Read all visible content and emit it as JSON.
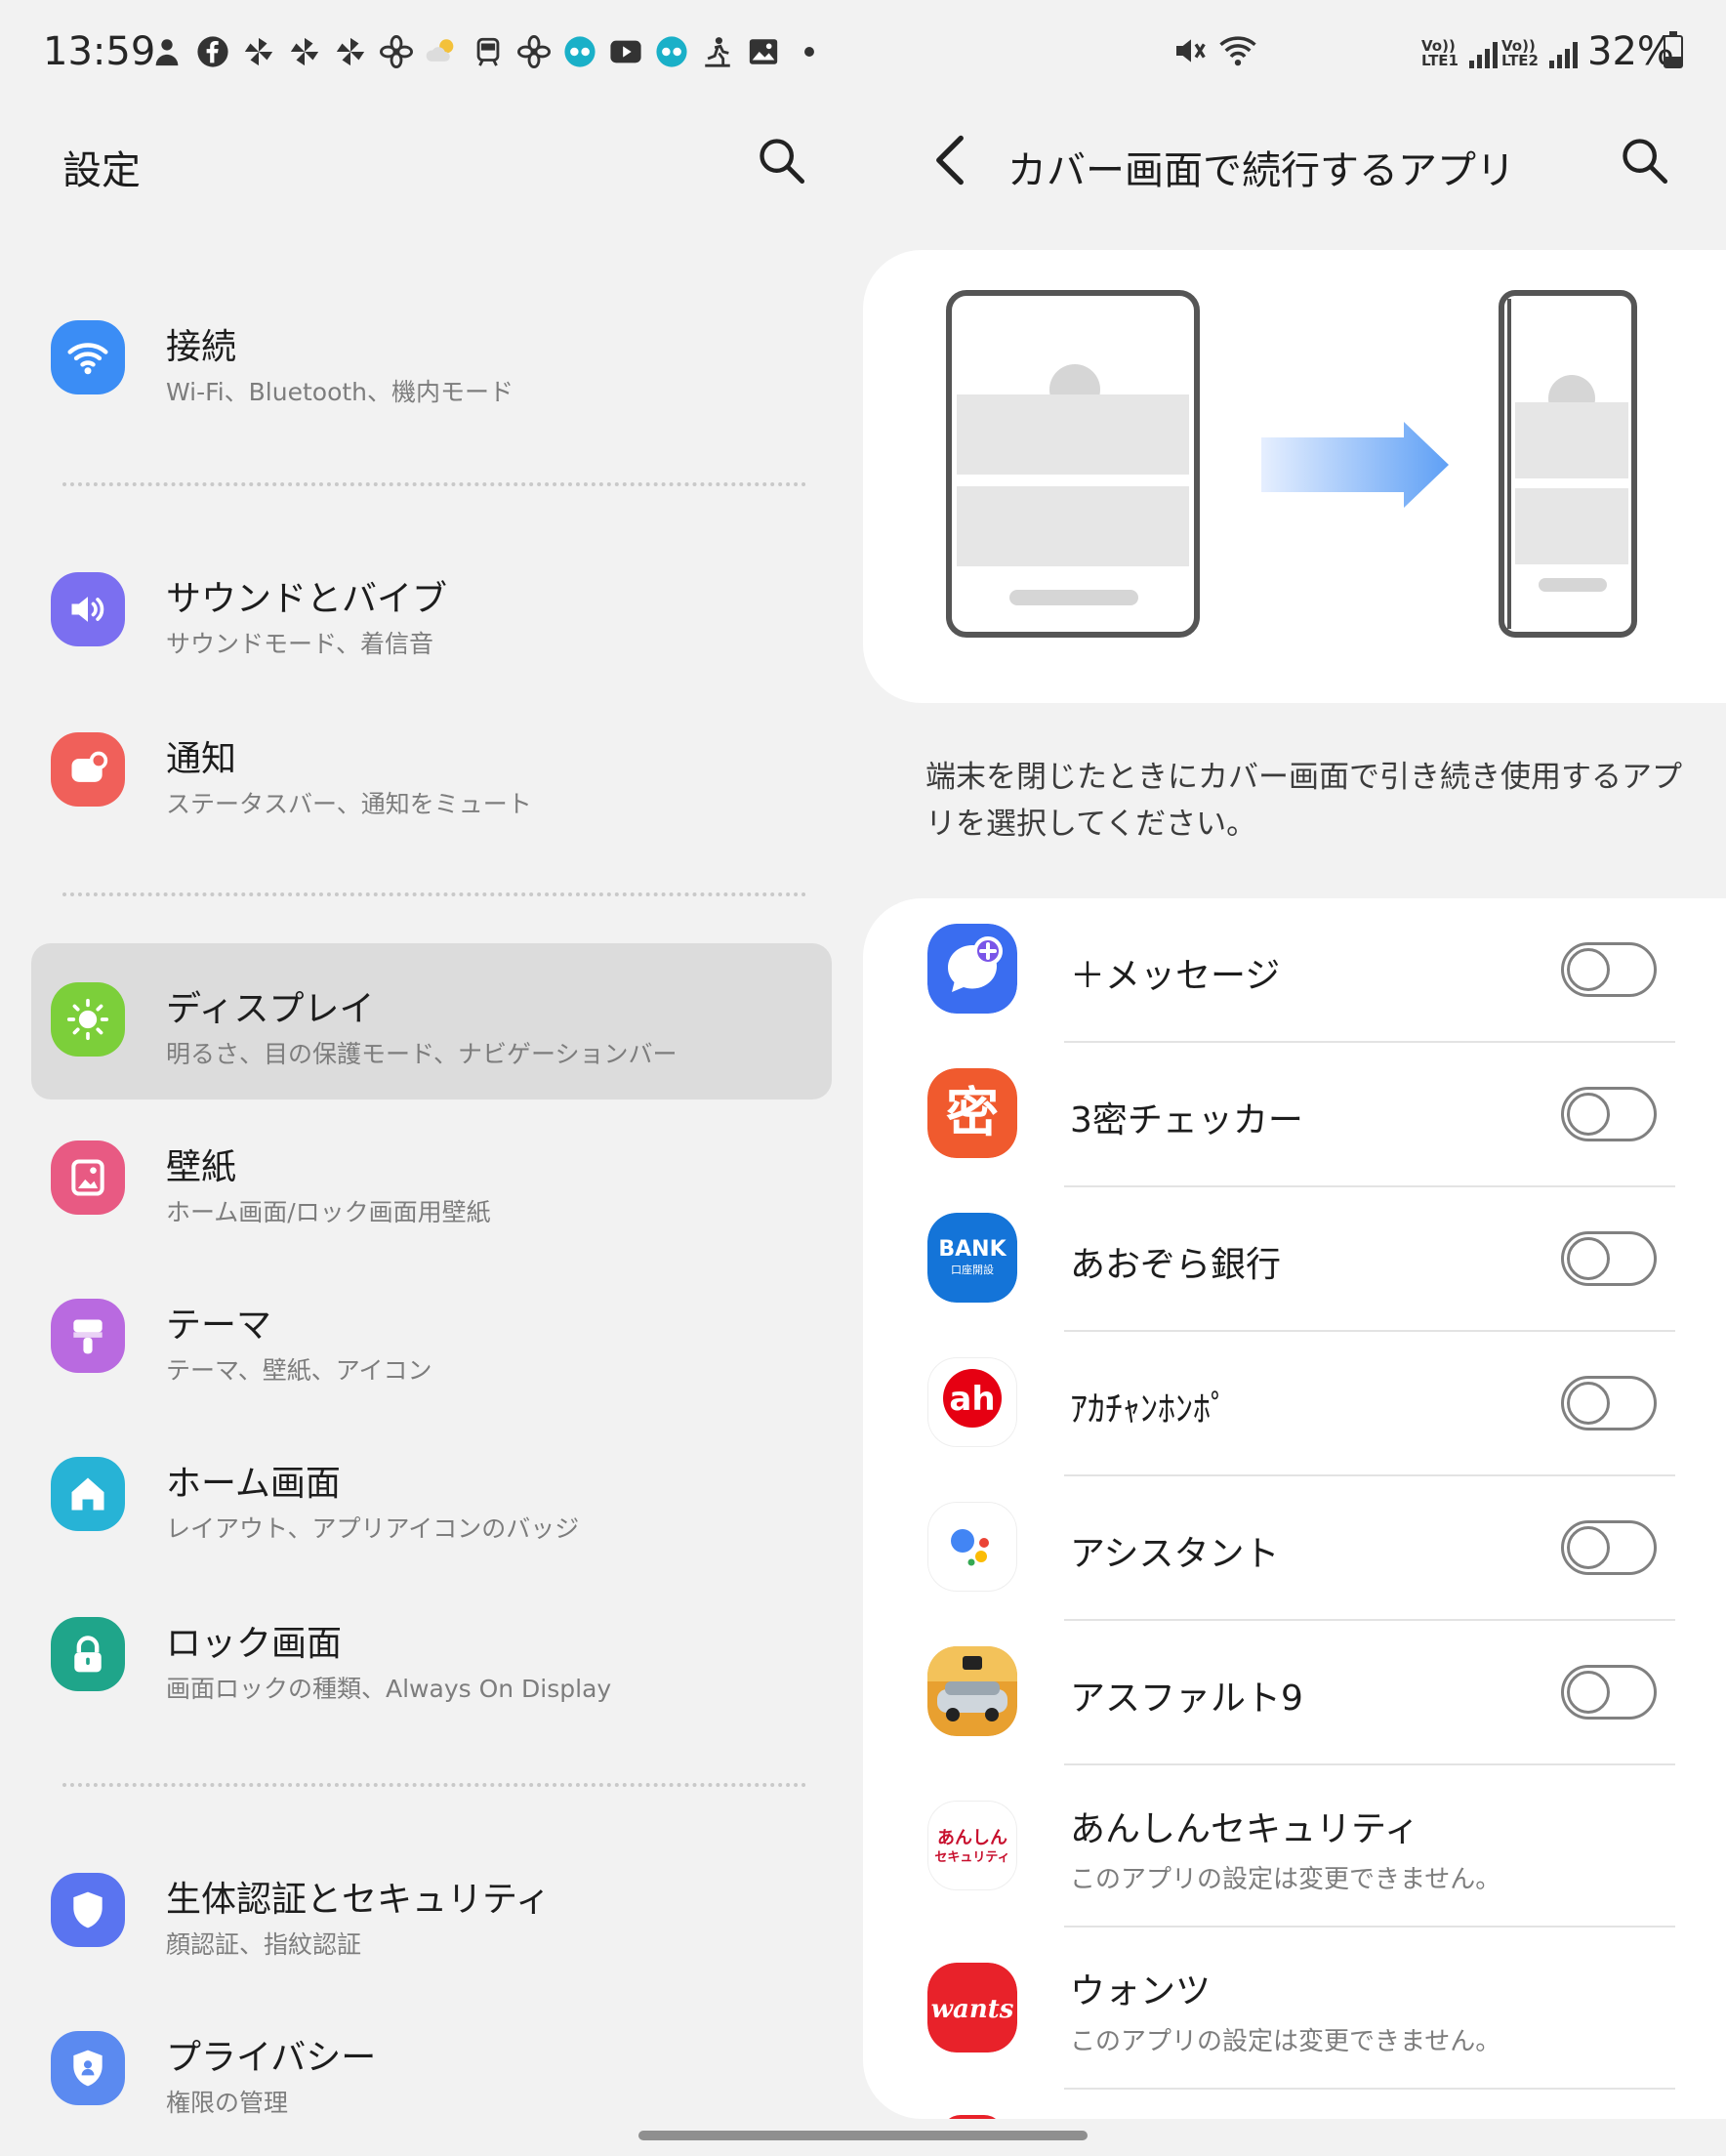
{
  "status_bar": {
    "time": "13:59",
    "notification_icons": [
      "person-pin-icon",
      "facebook-icon",
      "pinwheel-icon",
      "pinwheel-icon",
      "pinwheel-icon",
      "propeller-icon",
      "weather-icon",
      "train-icon",
      "propeller-icon",
      "chat-bubble-icon",
      "youtube-icon",
      "chat-bubble-icon",
      "runner-icon",
      "image-icon",
      "more-dot-icon"
    ],
    "sim1_label": "Vo)) LTE1",
    "sim2_label": "Vo)) LTE2",
    "battery_percent": "32%"
  },
  "settings": {
    "title": "設定",
    "items": [
      {
        "title": "接続",
        "subtitle": "Wi-Fi、Bluetooth、機内モード",
        "icon": "wifi-icon",
        "color": "#3b8df5"
      },
      {
        "title": "サウンドとバイブ",
        "subtitle": "サウンドモード、着信音",
        "icon": "speaker-icon",
        "color": "#7b6ff0"
      },
      {
        "title": "通知",
        "subtitle": "ステータスバー、通知をミュート",
        "icon": "notification-icon",
        "color": "#f0605a"
      },
      {
        "title": "ディスプレイ",
        "subtitle": "明るさ、目の保護モード、ナビゲーションバー",
        "icon": "sun-icon",
        "color": "#7ccf3a",
        "selected": true
      },
      {
        "title": "壁紙",
        "subtitle": "ホーム画面/ロック画面用壁紙",
        "icon": "wallpaper-icon",
        "color": "#e85a83"
      },
      {
        "title": "テーマ",
        "subtitle": "テーマ、壁紙、アイコン",
        "icon": "brush-icon",
        "color": "#b96ae0"
      },
      {
        "title": "ホーム画面",
        "subtitle": "レイアウト、アプリアイコンのバッジ",
        "icon": "home-icon",
        "color": "#27b3d6"
      },
      {
        "title": "ロック画面",
        "subtitle": "画面ロックの種類、Always On Display",
        "icon": "lock-icon",
        "color": "#1fa58a"
      },
      {
        "title": "生体認証とセキュリティ",
        "subtitle": "顔認証、指紋認証",
        "icon": "shield-icon",
        "color": "#5a74f0"
      },
      {
        "title": "プライバシー",
        "subtitle": "権限の管理",
        "icon": "privacy-shield-icon",
        "color": "#5b8af0"
      }
    ]
  },
  "cover_screen": {
    "title": "カバー画面で続行するアプリ",
    "description": "端末を閉じたときにカバー画面で引き続き使用するアプリを選択してください。",
    "apps": [
      {
        "name": "＋メッセージ",
        "icon": "plus-message-icon",
        "toggle": "off"
      },
      {
        "name": "3密チェッカー",
        "icon": "3mitsu-checker-icon",
        "toggle": "off"
      },
      {
        "name": "あおぞら銀行",
        "icon": "aozora-bank-icon",
        "icon_text": "BANK",
        "icon_subtext": "口座開設",
        "toggle": "off"
      },
      {
        "name": "ｱｶﾁｬﾝﾎﾝﾎﾟ",
        "icon": "akachan-honpo-icon",
        "icon_text": "ah",
        "toggle": "off"
      },
      {
        "name": "アシスタント",
        "icon": "assistant-icon",
        "toggle": "off"
      },
      {
        "name": "アスファルト9",
        "icon": "asphalt9-icon",
        "toggle": "off"
      },
      {
        "name": "あんしんセキュリティ",
        "subtitle": "このアプリの設定は変更できません。",
        "icon": "anshin-security-icon",
        "icon_text": "あんしん",
        "icon_subtext": "セキュリティ"
      },
      {
        "name": "ウォンツ",
        "subtitle": "このアプリの設定は変更できません。",
        "icon": "wants-icon",
        "icon_text": "wants"
      }
    ]
  }
}
